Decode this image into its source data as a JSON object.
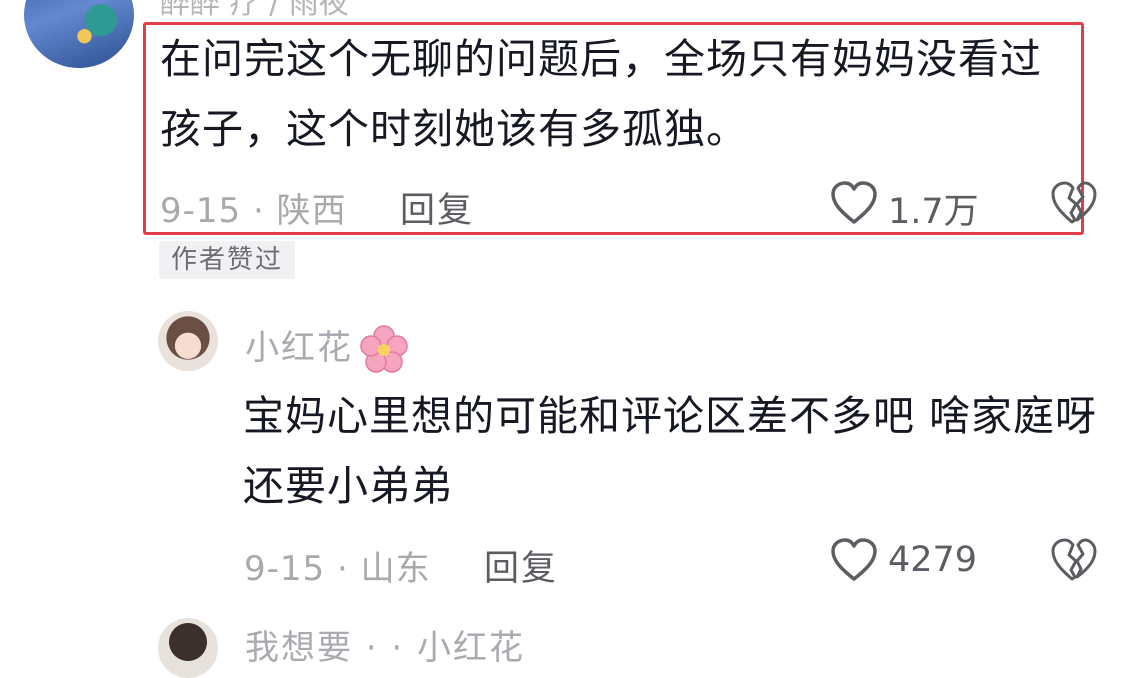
{
  "top_comment": {
    "username_partial": "醉醉 疗 / 雨夜",
    "text": "在问完这个无聊的问题后，全场只有妈妈没看过孩子，这个时刻她该有多孤独。",
    "date_location": "9-15 · 陕西",
    "reply_label": "回复",
    "like_count": "1.7万",
    "badge": "作者赞过"
  },
  "reply_comment": {
    "username": "小红花",
    "text": "宝妈心里想的可能和评论区差不多吧  啥家庭呀 还要小弟弟",
    "date_location": "9-15 · 山东",
    "reply_label": "回复",
    "like_count": "4279"
  },
  "next_comment": {
    "username_partial": "我想要 · · 小红花"
  },
  "colors": {
    "highlight_border": "#e23e48",
    "text_primary": "#161823",
    "text_secondary": "#a9a9ad",
    "badge_bg": "#f1f1f3"
  },
  "icons": [
    "heart-outline-icon",
    "broken-heart-icon",
    "cherry-blossom-emoji"
  ]
}
